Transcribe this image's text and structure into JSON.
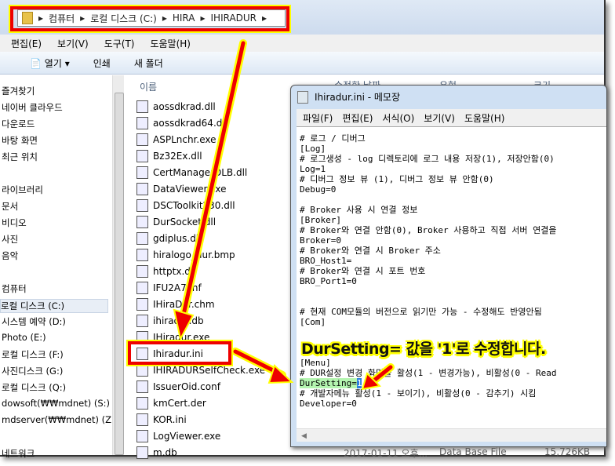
{
  "address": {
    "segments": [
      "컴퓨터",
      "로컬 디스크 (C:)",
      "HIRA",
      "IHIRADUR"
    ]
  },
  "menu": [
    "편집(E)",
    "보기(V)",
    "도구(T)",
    "도움말(H)"
  ],
  "toolbar": {
    "open": "열기",
    "print": "인쇄",
    "new_folder": "새 폴더"
  },
  "nav": [
    "즐겨찾기",
    "네이버 클라우드",
    "다운로드",
    "바탕 화면",
    "최근 위치",
    "라이브러리",
    "문서",
    "비디오",
    "사진",
    "음악",
    "컴퓨터",
    "로컬 디스크 (C:)",
    "시스템 예약 (D:)",
    "Photo (E:)",
    "로컬 디스크 (F:)",
    "사진디스크 (G:)",
    "로컬 디스크 (Q:)",
    "dowsoft(₩₩mdnet) (S:)",
    "mdserver(₩₩mdnet) (Z:)",
    "네트워크"
  ],
  "files": {
    "header": "이름",
    "col_date": "수정한 날짜",
    "col_type": "유형",
    "col_size": "크기",
    "items": [
      "aossdkrad.dll",
      "aossdkrad64.dll",
      "ASPLnchr.exe",
      "Bz32Ex.dll",
      "CertManagerDLB.dll",
      "DataViewer.exe",
      "DSCToolkit230.dll",
      "DurSocket.dll",
      "gdiplus.dll",
      "hiralogo_dur.bmp",
      "httptx.dll",
      "IFU2A7.inf",
      "IHiraDur.chm",
      "ihiradur.db",
      "IHiradur.exe",
      "Ihiradur.ini",
      "IHIRADURSelfCheck.exe",
      "IssuerOid.conf",
      "kmCert.der",
      "KOR.ini",
      "LogViewer.exe",
      "m.db"
    ],
    "status": {
      "date": "2017-01-11 오후...",
      "type": "Data Base File",
      "size": "15,726KB"
    }
  },
  "notepad": {
    "title": "Ihiradur.ini - 메모장",
    "menu": [
      "파일(F)",
      "편집(E)",
      "서식(O)",
      "보기(V)",
      "도움말(H)"
    ],
    "lines": [
      "# 로그 / 디버그",
      "[Log]",
      "# 로그생성 - log 디렉토리에 로그 내용 저장(1), 저장안함(0)",
      "Log=1",
      "# 디버그 정보 뷰 (1), 디버그 정보 뷰 안함(0)",
      "Debug=0",
      "",
      "# Broker 사용 시 연결 정보",
      "[Broker]",
      "# Broker와 연결 안함(0), Broker 사용하고 직접 서버 연결을",
      "Broker=0",
      "# Broker와 연결 시 Broker 주소",
      "BRO_Host1=",
      "# Broker와 연결 시 포트 번호",
      "BRO_Port1=0",
      "",
      "",
      "# 현재 COM모듈의 버전으로 읽기만 가능 - 수정해도 반영안됨",
      "[Com]",
      "",
      "",
      "",
      "[Menu]",
      "# DUR설정 변경 화면을 활성(1 - 변경가능), 비활성(0 - Read"
    ],
    "dur_key": "DurSetting=",
    "dur_value": "1",
    "after": [
      "# 개발자메뉴 활성(1 - 보이기), 비활성(0 - 감추기) 시킴",
      "Developer=0"
    ]
  },
  "annotation": "DurSetting= 값을 '1'로 수정합니다."
}
